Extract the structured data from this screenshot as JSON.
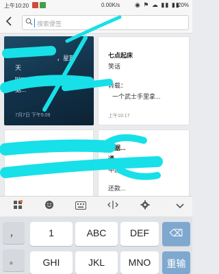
{
  "status_bar": {
    "time": "上午10:20",
    "net_speed": "0.00K/s",
    "status_icons": "◉ ⚑ ☁ ▮▮ ▮▮",
    "battery": "20%"
  },
  "top_bar": {
    "back_icon": "back-chevron-icon",
    "search_placeholder": "搜索便签"
  },
  "notes": [
    {
      "text_line1": "，星期",
      "text_line2": "天",
      "text_line3": "trimnean函数",
      "text_line4": "据...",
      "time": "7月7日 下午5:09"
    },
    {
      "title": "七点起床",
      "body1": "笑话",
      "body2": "转载：",
      "body3": "一个武士手里拿...",
      "time": "上午10:17"
    },
    {
      "line1": "",
      "line2": "",
      "line3": "",
      "line4": ""
    },
    {
      "line1": "数据...",
      "line2": "通...",
      "line3": "中国...",
      "line4": "还款..."
    }
  ],
  "keyboard_toolbar": {
    "icons": [
      "grid-menu-icon",
      "emoji-icon",
      "keyboard-icon",
      "cursor-move-icon",
      "settings-icon",
      "collapse-icon"
    ]
  },
  "keyboard": {
    "row1": {
      "left": "，",
      "keys": [
        "1",
        "ABC",
        "DEF"
      ],
      "right": "⌫"
    },
    "row2": {
      "left": "。",
      "keys": [
        "GHI",
        "JKL",
        "MNO"
      ],
      "right": "重输"
    }
  }
}
